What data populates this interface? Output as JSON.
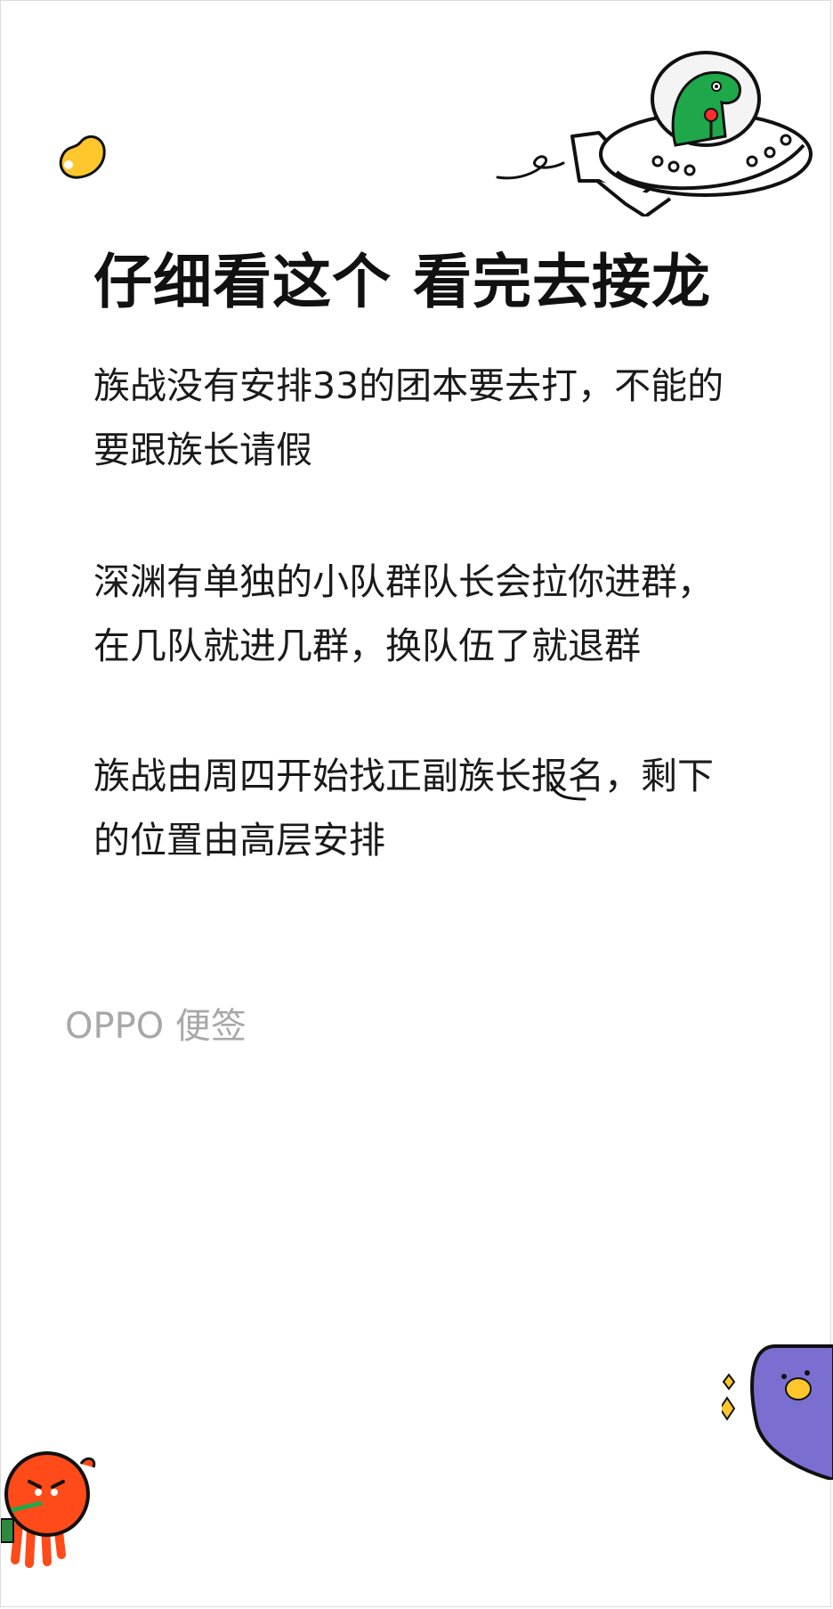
{
  "note": {
    "title": "仔细看这个 看完去接龙",
    "paragraphs": [
      {
        "lines": [
          "族战没有安排33的团本要去打，不能的",
          "要跟族长请假"
        ]
      },
      {
        "lines": [
          "深渊有单独的小队群队长会拉你进群，",
          "在几队就进几群，换队伍了就退群"
        ]
      },
      {
        "lines": [
          "族战由周四开始找正副族长报名，剩下",
          "的位置由高层安排"
        ]
      }
    ],
    "brand": "OPPO 便签"
  },
  "decorations": {
    "bean": "yellow-bean-icon",
    "ufo": "dinosaur-ufo-sticker",
    "purple": "purple-character-sticker",
    "orange": "orange-octopus-sticker"
  },
  "colors": {
    "background": "#ffffff",
    "text": "#1a1a1a",
    "brand": "#a8a8a8",
    "dino": "#1fa84a",
    "bean": "#ffc72c",
    "purple": "#7a6fd0",
    "orange": "#ff4a1a"
  }
}
